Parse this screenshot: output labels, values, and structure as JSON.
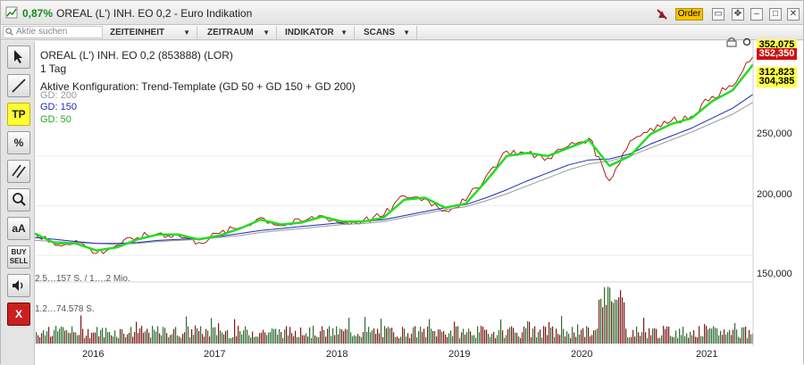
{
  "titlebar": {
    "change": "0,87%",
    "title": "OREAL (L') INH. EO 0,2 - Euro Indikation",
    "order_label": "Order",
    "colors": {
      "change": "#1a8a1a",
      "order_bg": "#f5c400"
    }
  },
  "toolbar": {
    "search_placeholder": "Aktie suchen",
    "menus": [
      "ZEITEINHEIT",
      "ZEITRAUM",
      "INDIKATOR",
      "SCANS"
    ]
  },
  "sidebar": {
    "buttons": [
      {
        "name": "cursor-tool-button",
        "label": ""
      },
      {
        "name": "line-tool-button",
        "label": ""
      },
      {
        "name": "tp-button",
        "label": "TP"
      },
      {
        "name": "percent-tool-button",
        "label": "%"
      },
      {
        "name": "parallel-tool-button",
        "label": ""
      },
      {
        "name": "zoom-button",
        "label": ""
      },
      {
        "name": "font-size-button",
        "label": "aA"
      },
      {
        "name": "buy-sell-button",
        "label": "BUY SELL"
      },
      {
        "name": "sound-button",
        "label": ""
      },
      {
        "name": "close-chart-button",
        "label": "X"
      }
    ]
  },
  "chart": {
    "instrument": "OREAL (L') INH. EO 0,2 (853888) (LOR)",
    "interval": "1 Tag",
    "config": "Aktive Konfiguration: Trend-Template (GD 50 + GD 150 + GD 200)",
    "legend": [
      {
        "label": "GD: 200",
        "color": "#999999"
      },
      {
        "label": "GD: 150",
        "color": "#1d2bb5"
      },
      {
        "label": "GD: 50",
        "color": "#22cc22"
      }
    ],
    "volume_text_1": "2.5…157 S. / 1….2 Mio.",
    "volume_text_2": "1.2…74.578 S.",
    "price_tags": [
      {
        "value": "352,075",
        "bg": "#ffff44",
        "fg": "#000000"
      },
      {
        "value": "352,350",
        "bg": "#cc1111",
        "fg": "#ffffff"
      },
      {
        "value": "312,823",
        "bg": "#ffff44",
        "fg": "#000000"
      },
      {
        "value": "304,385",
        "bg": "#ffff44",
        "fg": "#000000"
      }
    ],
    "y_ticks": [
      "250,000",
      "200,000",
      "150,000"
    ],
    "x_ticks": [
      "2016",
      "2017",
      "2018",
      "2019",
      "2020",
      "2021"
    ]
  },
  "chart_data": {
    "type": "line",
    "title": "OREAL (L') INH. EO 0,2 (853888) (LOR)",
    "xlabel": "",
    "ylabel": "",
    "ylim": [
      125,
      362
    ],
    "x": [
      "2015-07",
      "2015-09",
      "2015-11",
      "2016-01",
      "2016-03",
      "2016-05",
      "2016-07",
      "2016-09",
      "2016-11",
      "2017-01",
      "2017-03",
      "2017-05",
      "2017-07",
      "2017-09",
      "2017-11",
      "2018-01",
      "2018-03",
      "2018-05",
      "2018-07",
      "2018-09",
      "2018-11",
      "2019-01",
      "2019-03",
      "2019-05",
      "2019-07",
      "2019-09",
      "2019-11",
      "2020-01",
      "2020-03",
      "2020-05",
      "2020-07",
      "2020-09",
      "2020-11",
      "2021-01",
      "2021-03",
      "2021-05"
    ],
    "series": [
      {
        "name": "OREAL (L') INH. EO 0,2",
        "values": [
          172,
          160,
          165,
          152,
          160,
          168,
          172,
          170,
          163,
          172,
          178,
          188,
          180,
          184,
          190,
          182,
          185,
          190,
          210,
          207,
          195,
          205,
          230,
          255,
          252,
          248,
          260,
          268,
          225,
          265,
          278,
          285,
          290,
          310,
          320,
          350
        ]
      },
      {
        "name": "GD: 200",
        "values": [
          165,
          164,
          163,
          162,
          161,
          162,
          164,
          165,
          166,
          168,
          170,
          173,
          175,
          177,
          179,
          181,
          182,
          184,
          188,
          192,
          196,
          199,
          205,
          212,
          220,
          228,
          236,
          242,
          245,
          250,
          258,
          266,
          274,
          283,
          292,
          304
        ]
      },
      {
        "name": "GD: 150",
        "values": [
          168,
          166,
          164,
          162,
          162,
          163,
          165,
          166,
          167,
          169,
          172,
          175,
          177,
          179,
          181,
          183,
          184,
          186,
          190,
          194,
          198,
          201,
          208,
          216,
          225,
          233,
          241,
          246,
          247,
          252,
          262,
          270,
          278,
          288,
          298,
          312
        ]
      },
      {
        "name": "GD: 50",
        "values": [
          172,
          162,
          162,
          155,
          158,
          166,
          171,
          171,
          166,
          170,
          177,
          186,
          181,
          183,
          189,
          184,
          184,
          188,
          206,
          208,
          198,
          202,
          225,
          250,
          253,
          250,
          258,
          266,
          240,
          250,
          272,
          282,
          288,
          305,
          316,
          342
        ]
      }
    ]
  }
}
